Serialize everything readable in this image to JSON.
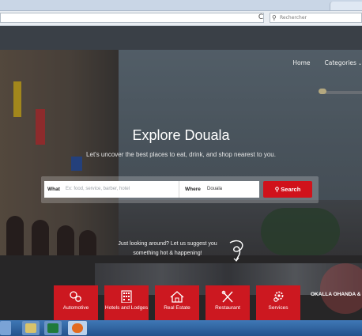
{
  "browser": {
    "search_placeholder": "Rechercher",
    "reload_glyph": "C"
  },
  "nav": {
    "items": [
      {
        "label": "Home"
      },
      {
        "label": "Categories"
      }
    ]
  },
  "hero": {
    "title": "Explore Douala",
    "subtitle": "Let's uncover the best places to eat, drink, and shop nearest to you."
  },
  "search": {
    "what_label": "What",
    "what_placeholder": "Ex: food, service, barber, hotel",
    "where_label": "Where",
    "where_value": "Douala",
    "button_label": "Search",
    "button_icon": "search-icon"
  },
  "suggest": {
    "line1": "Just looking around? Let us suggest you",
    "line2": "something hot & happening!"
  },
  "categories": [
    {
      "label": "Automotive",
      "icon": "gears-icon"
    },
    {
      "label": "Hotels and Lodges",
      "icon": "building-icon"
    },
    {
      "label": "Real Estate",
      "icon": "house-icon"
    },
    {
      "label": "Restaurant",
      "icon": "utensils-icon"
    },
    {
      "label": "Services",
      "icon": "gear-icon"
    }
  ],
  "overlay_text": "OKALLA OHANDA &",
  "colors": {
    "accent": "#cc1820",
    "taskbar": "#2f5f9e"
  }
}
